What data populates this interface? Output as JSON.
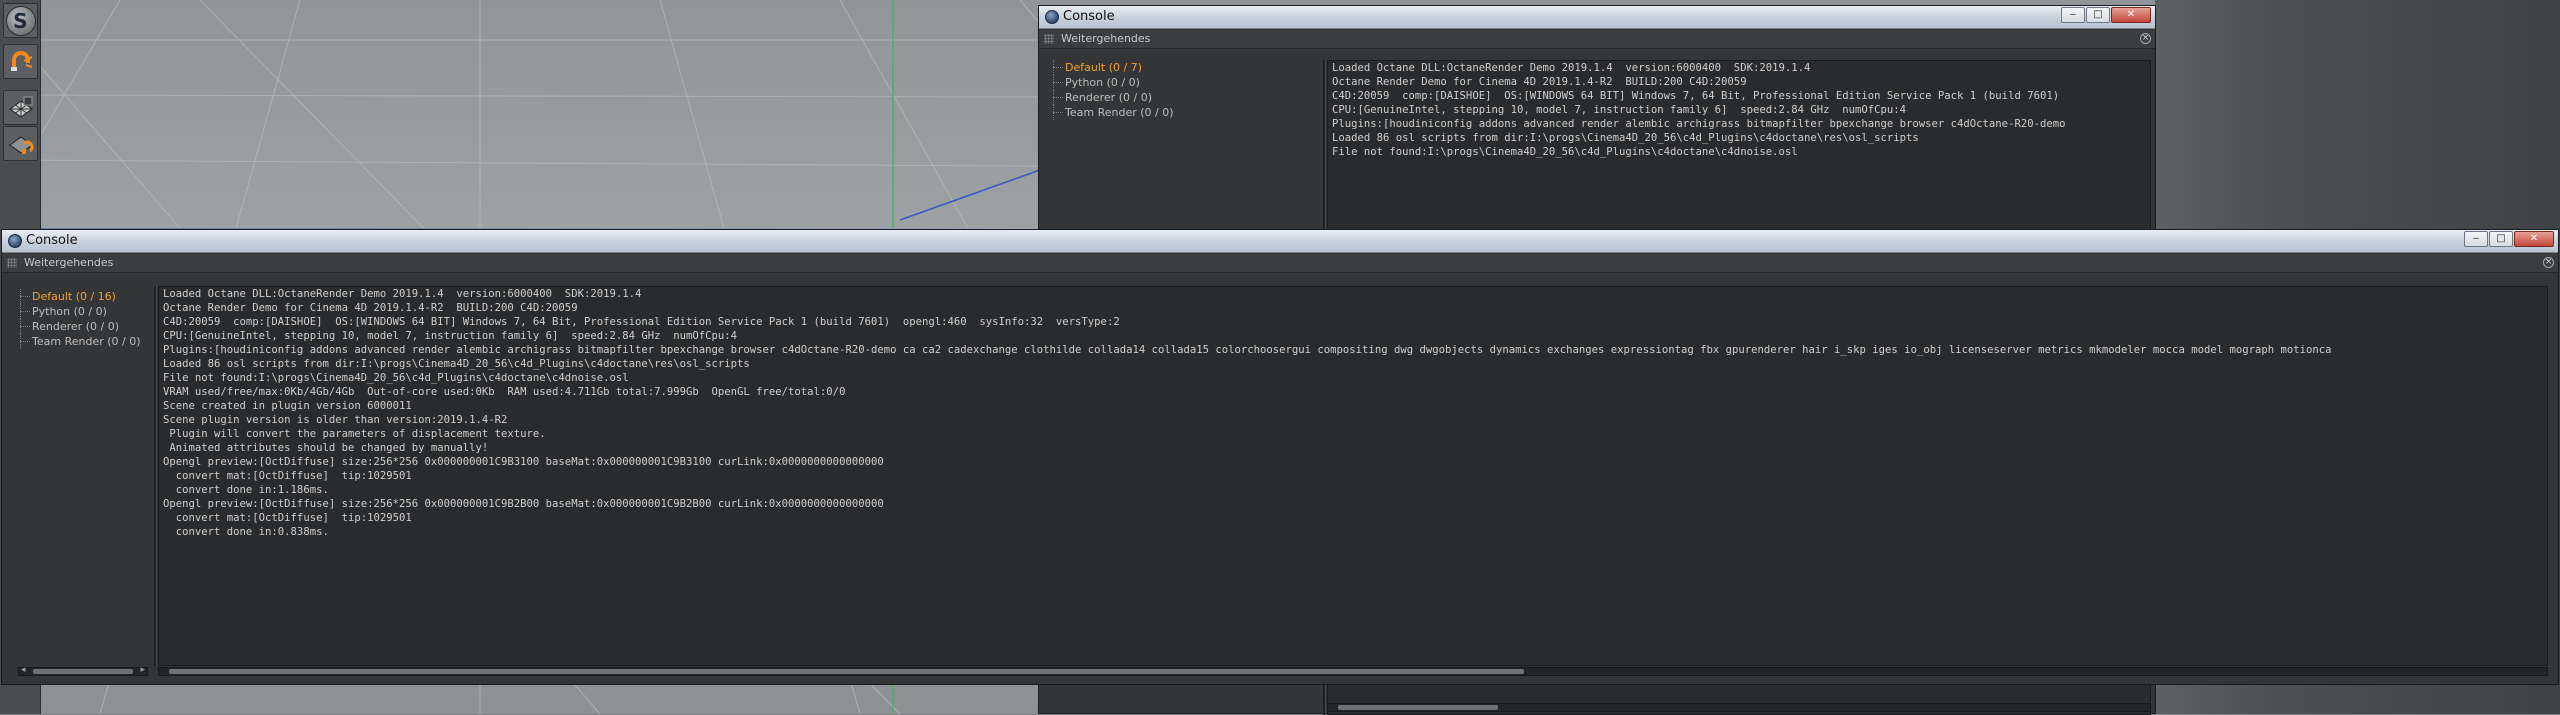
{
  "background_console": {
    "title": "Console",
    "menu": "Weitergehendes",
    "tree": [
      {
        "label": "Default (0 / 7)",
        "active": true
      },
      {
        "label": "Python (0 / 0)",
        "active": false
      },
      {
        "label": "Renderer (0 / 0)",
        "active": false
      },
      {
        "label": "Team Render  (0 / 0)",
        "active": false
      }
    ],
    "log": [
      "Loaded Octane DLL:OctaneRender Demo 2019.1.4  version:6000400  SDK:2019.1.4",
      "Octane Render Demo for Cinema 4D 2019.1.4-R2  BUILD:200 C4D:20059",
      "C4D:20059  comp:[DAISHOE]  OS:[WINDOWS 64 BIT] Windows 7, 64 Bit, Professional Edition Service Pack 1 (build 7601)",
      "CPU:[GenuineIntel, stepping 10, model 7, instruction family 6]  speed:2.84 GHz  numOfCpu:4",
      "Plugins:[houdiniconfig addons advanced render alembic archigrass bitmapfilter bpexchange browser c4dOctane-R20-demo",
      "Loaded 86 osl scripts from dir:I:\\progs\\Cinema4D_20_56\\c4d_Plugins\\c4doctane\\res\\osl_scripts",
      "File not found:I:\\progs\\Cinema4D_20_56\\c4d_Plugins\\c4doctane\\c4dnoise.osl"
    ]
  },
  "main_console": {
    "title": "Console",
    "menu": "Weitergehendes",
    "tree": [
      {
        "label": "Default (0 / 16)",
        "active": true
      },
      {
        "label": "Python (0 / 0)",
        "active": false
      },
      {
        "label": "Renderer (0 / 0)",
        "active": false
      },
      {
        "label": "Team Render  (0 / 0)",
        "active": false
      }
    ],
    "log": [
      "Loaded Octane DLL:OctaneRender Demo 2019.1.4  version:6000400  SDK:2019.1.4",
      "Octane Render Demo for Cinema 4D 2019.1.4-R2  BUILD:200 C4D:20059",
      "C4D:20059  comp:[DAISHOE]  OS:[WINDOWS 64 BIT] Windows 7, 64 Bit, Professional Edition Service Pack 1 (build 7601)  opengl:460  sysInfo:32  versType:2",
      "CPU:[GenuineIntel, stepping 10, model 7, instruction family 6]  speed:2.84 GHz  numOfCpu:4",
      "Plugins:[houdiniconfig addons advanced render alembic archigrass bitmapfilter bpexchange browser c4dOctane-R20-demo ca ca2 cadexchange clothilde collada14 collada15 colorchoosergui compositing dwg dwgobjects dynamics exchanges expressiontag fbx gpurenderer hair i_skp iges io_obj licenseserver metrics mkmodeler mocca model mograph motionca",
      "Loaded 86 osl scripts from dir:I:\\progs\\Cinema4D_20_56\\c4d_Plugins\\c4doctane\\res\\osl_scripts",
      "File not found:I:\\progs\\Cinema4D_20_56\\c4d_Plugins\\c4doctane\\c4dnoise.osl",
      "VRAM used/free/max:0Kb/4Gb/4Gb  Out-of-core used:0Kb  RAM used:4.711Gb total:7.999Gb  OpenGL free/total:0/0",
      "Scene created in plugin version 6000011",
      "Scene plugin version is older than version:2019.1.4-R2",
      " Plugin will convert the parameters of displacement texture.",
      " Animated attributes should be changed by manually!",
      "Opengl preview:[OctDiffuse] size:256*256 0x000000001C9B3100 baseMat:0x000000001C9B3100 curLink:0x0000000000000000",
      "  convert mat:[OctDiffuse]  tip:1029501",
      "  convert done in:1.186ms.",
      "Opengl preview:[OctDiffuse] size:256*256 0x000000001C9B2B00 baseMat:0x000000001C9B2B00 curLink:0x0000000000000000",
      "  convert mat:[OctDiffuse]  tip:1029501",
      "  convert done in:0.838ms."
    ]
  },
  "icons": {
    "app": "cinema4d-icon",
    "snap_magnet": "magnet-icon",
    "workplane": "grid-checker-icon",
    "snap_settings": "snap-icon",
    "grip": "grip-dots-icon",
    "close": "close-icon",
    "minimize": "minimize-icon",
    "maximize": "maximize-icon"
  },
  "tool_s_label": "S",
  "window_buttons": {
    "minimize": "‒",
    "maximize": "□",
    "close": "✕"
  },
  "colors": {
    "tree_active": "#f0a030",
    "log_text": "#cfcfcf",
    "window_bg": "#333537"
  }
}
